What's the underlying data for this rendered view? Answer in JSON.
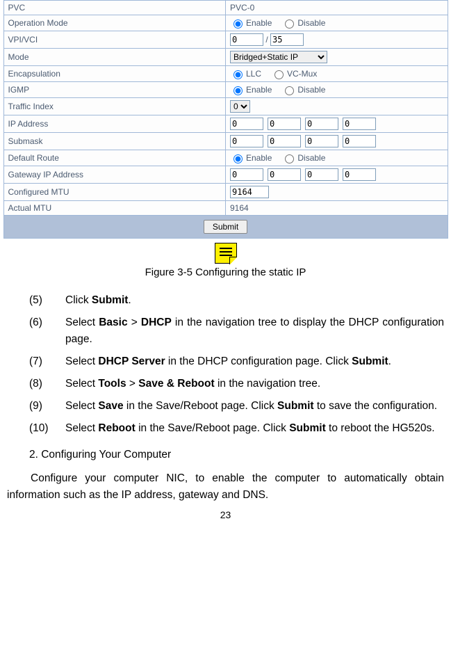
{
  "table": {
    "rows": {
      "pvc_label": "PVC",
      "pvc_value": "PVC-0",
      "op_mode_label": "Operation Mode",
      "enable": "Enable",
      "disable": "Disable",
      "vpi_vci_label": "VPI/VCI",
      "vpi_value": "0",
      "vci_value": "35",
      "slash": "/",
      "mode_label": "Mode",
      "mode_value": "Bridged+Static IP",
      "encap_label": "Encapsulation",
      "llc": "LLC",
      "vcmux": "VC-Mux",
      "igmp_label": "IGMP",
      "traffic_label": "Traffic Index",
      "traffic_value": "0",
      "ip_label": "IP Address",
      "submask_label": "Submask",
      "defroute_label": "Default Route",
      "gateway_label": "Gateway IP Address",
      "cfg_mtu_label": "Configured MTU",
      "cfg_mtu_value": "9164",
      "actual_mtu_label": "Actual MTU",
      "actual_mtu_value": "9164",
      "zero": "0",
      "submit": "Submit"
    }
  },
  "caption": "Figure 3-5 Configuring the static IP",
  "steps": {
    "n5": "(5)",
    "t5a": "Click ",
    "t5b": "Submit",
    "t5c": ".",
    "n6": "(6)",
    "t6a": "Select ",
    "t6b": "Basic",
    "t6c": " > ",
    "t6d": "DHCP",
    "t6e": " in the navigation tree to display the DHCP configuration page.",
    "n7": "(7)",
    "t7a": "Select ",
    "t7b": "DHCP Server",
    "t7c": " in the DHCP configuration page. Click ",
    "t7d": "Submit",
    "t7e": ".",
    "n8": "(8)",
    "t8a": "Select ",
    "t8b": "Tools",
    "t8c": " > ",
    "t8d": "Save & Reboot",
    "t8e": " in the navigation tree.",
    "n9": "(9)",
    "t9a": "Select ",
    "t9b": "Save",
    "t9c": " in the Save/Reboot page. Click ",
    "t9d": "Submit",
    "t9e": " to save the configuration.",
    "n10": "(10)",
    "t10a": "Select ",
    "t10b": "Reboot",
    "t10c": " in the Save/Reboot page. Click ",
    "t10d": "Submit",
    "t10e": " to reboot the HG520s."
  },
  "section2": "2. Configuring Your Computer",
  "para2": "Configure your computer NIC, to enable the computer to automatically obtain information such as the IP address, gateway and DNS.",
  "page": "23"
}
